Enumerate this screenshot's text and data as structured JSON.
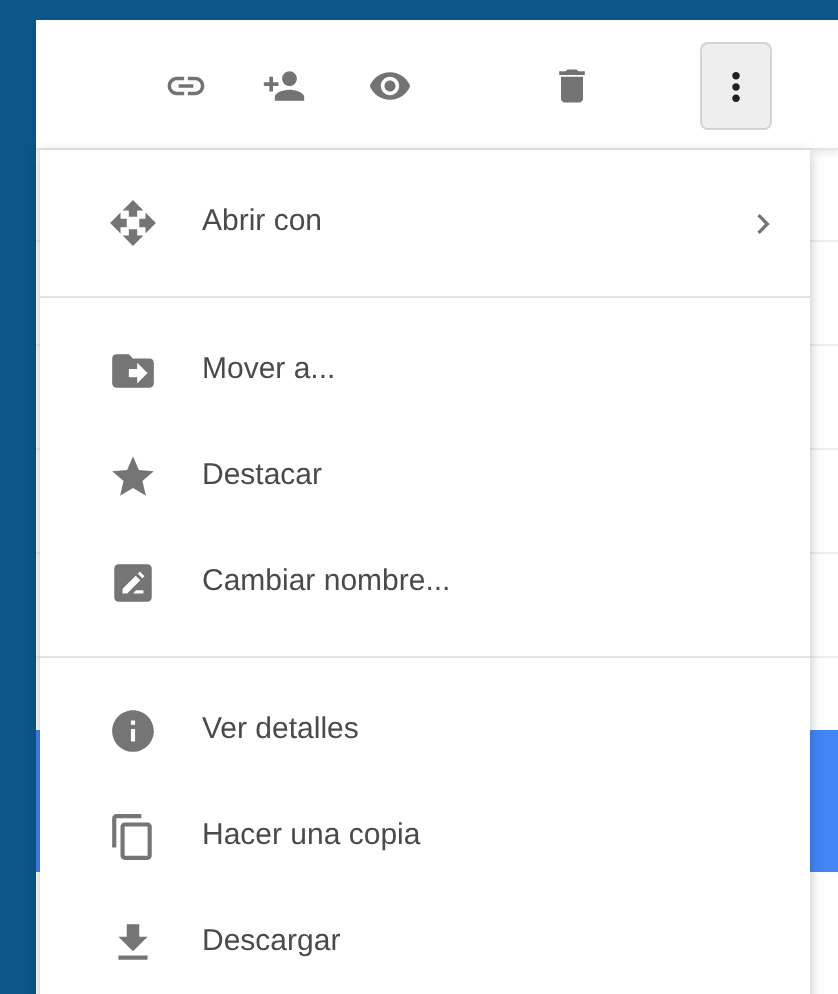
{
  "toolbar": {
    "buttons": [
      {
        "kind": "link",
        "selected": false
      },
      {
        "kind": "share",
        "selected": false
      },
      {
        "kind": "preview",
        "selected": false
      },
      {
        "kind": "delete",
        "selected": false
      },
      {
        "kind": "more",
        "selected": true
      }
    ]
  },
  "menu": {
    "sections": [
      [
        {
          "kind": "open",
          "label": "Abrir con",
          "submenu": true
        }
      ],
      [
        {
          "kind": "move",
          "label": "Mover a...",
          "submenu": false
        },
        {
          "kind": "star",
          "label": "Destacar",
          "submenu": false
        },
        {
          "kind": "rename",
          "label": "Cambiar nombre...",
          "submenu": false
        }
      ],
      [
        {
          "kind": "info",
          "label": "Ver detalles",
          "submenu": false
        },
        {
          "kind": "copy",
          "label": "Hacer una copia",
          "submenu": false
        },
        {
          "kind": "download",
          "label": "Descargar",
          "submenu": false
        }
      ]
    ]
  }
}
